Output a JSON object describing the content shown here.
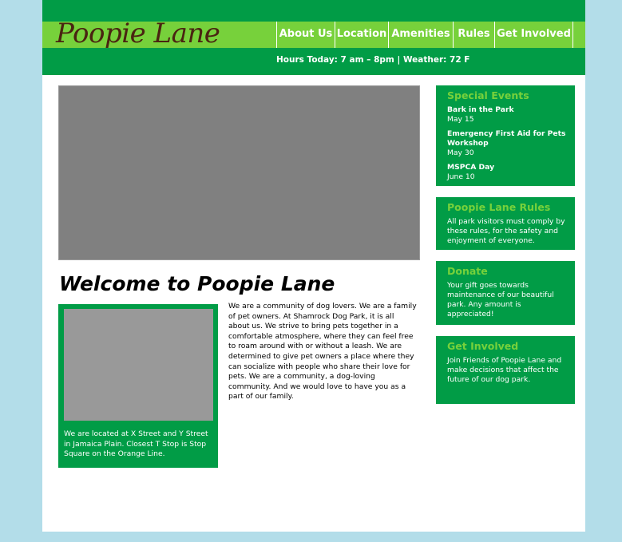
{
  "header": {
    "logo": "Poopie Lane",
    "nav": [
      "About Us",
      "Location",
      "Amenities",
      "Rules",
      "Get Involved"
    ],
    "status": "Hours Today: 7 am – 8pm | Weather: 72 F"
  },
  "main": {
    "title": "Welcome to Poopie Lane",
    "location_text": "We are located at X Street and Y Street in Jamaica Plain. Closest T Stop is Stop Square on the Orange Line.",
    "intro_text": "We are a community of dog lovers. We are a family of pet owners. At Shamrock Dog Park, it is all about us. We strive to bring pets together in a comfortable atmosphere, where they can feel free to roam around with or without a leash. We are determined to give pet owners a place where they can socialize with people who share their love for pets. We are a community, a dog-loving community. And we would love to have you as a part of our family."
  },
  "sidebar": {
    "events": {
      "title": "Special Events",
      "items": [
        {
          "name": "Bark in the Park",
          "date": "May 15"
        },
        {
          "name": "Emergency First Aid for Pets Workshop",
          "date": "May 30"
        },
        {
          "name": "MSPCA Day",
          "date": "June 10"
        }
      ]
    },
    "rules": {
      "title": "Poopie Lane Rules",
      "text": "All park visitors must comply by these rules, for the safety and enjoyment of everyone."
    },
    "donate": {
      "title": "Donate",
      "text": "Your gift goes towards maintenance of our beautiful park. Any amount is appreciated!"
    },
    "involved": {
      "title": "Get Involved",
      "text": "Join Friends of Poopie Lane and make decisions that affect the future of our dog park."
    }
  },
  "colors": {
    "dark_green": "#019c46",
    "light_green": "#77d13b",
    "logo_brown": "#4a2411",
    "page_background": "#b3dde9"
  }
}
